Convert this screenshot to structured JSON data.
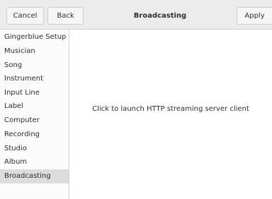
{
  "header": {
    "cancel_label": "Cancel",
    "back_label": "Back",
    "title": "Broadcasting",
    "apply_label": "Apply"
  },
  "sidebar": {
    "items": [
      {
        "label": "Gingerblue Setup"
      },
      {
        "label": "Musician"
      },
      {
        "label": "Song"
      },
      {
        "label": "Instrument"
      },
      {
        "label": "Input Line"
      },
      {
        "label": "Label"
      },
      {
        "label": "Computer"
      },
      {
        "label": "Recording"
      },
      {
        "label": "Studio"
      },
      {
        "label": "Album"
      },
      {
        "label": "Broadcasting"
      }
    ],
    "selected": "Broadcasting"
  },
  "main": {
    "launch_text": "Click to launch HTTP streaming server client"
  },
  "colors": {
    "headerbar": "#ececec",
    "selected_row": "#dcdcdc",
    "text": "#2e2e2e"
  }
}
